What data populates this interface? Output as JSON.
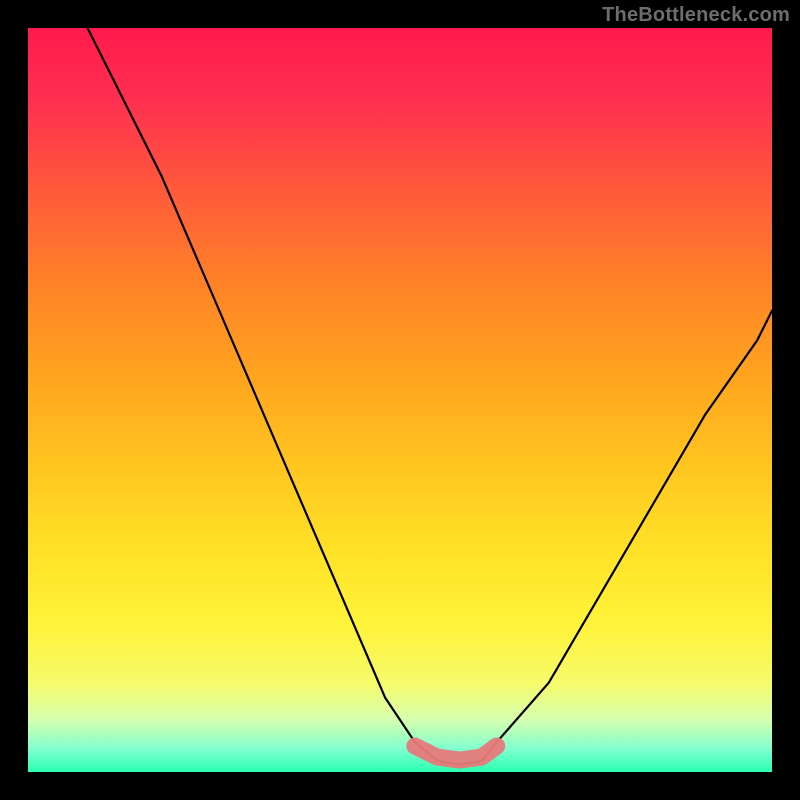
{
  "watermark": "TheBottleneck.com",
  "chart_data": {
    "type": "line",
    "title": "",
    "xlabel": "",
    "ylabel": "",
    "xlim": [
      0,
      100
    ],
    "ylim": [
      0,
      100
    ],
    "series": [
      {
        "name": "curve",
        "x": [
          8,
          12,
          18,
          24,
          30,
          36,
          42,
          48,
          52,
          55,
          58,
          61,
          63,
          70,
          77,
          84,
          91,
          98,
          100
        ],
        "y": [
          100,
          92,
          80,
          66,
          52,
          38,
          24,
          10,
          4,
          1.5,
          1,
          1.5,
          4,
          12,
          24,
          36,
          48,
          58,
          62
        ]
      }
    ],
    "highlight": {
      "name": "bottom-band",
      "x": [
        52,
        55,
        58,
        61,
        63
      ],
      "y": [
        3.5,
        2.0,
        1.6,
        2.0,
        3.5
      ]
    },
    "gradient_stops": [
      {
        "pos": 0.0,
        "color": "#ff1a4d"
      },
      {
        "pos": 0.1,
        "color": "#ff3050"
      },
      {
        "pos": 0.22,
        "color": "#ff5a3a"
      },
      {
        "pos": 0.34,
        "color": "#ff8128"
      },
      {
        "pos": 0.46,
        "color": "#ffa21f"
      },
      {
        "pos": 0.58,
        "color": "#ffc320"
      },
      {
        "pos": 0.7,
        "color": "#ffe126"
      },
      {
        "pos": 0.8,
        "color": "#fff33a"
      },
      {
        "pos": 0.88,
        "color": "#f6fb6a"
      },
      {
        "pos": 0.93,
        "color": "#d6ffb0"
      },
      {
        "pos": 0.97,
        "color": "#7dffcf"
      },
      {
        "pos": 1.0,
        "color": "#2bffb2"
      }
    ]
  }
}
